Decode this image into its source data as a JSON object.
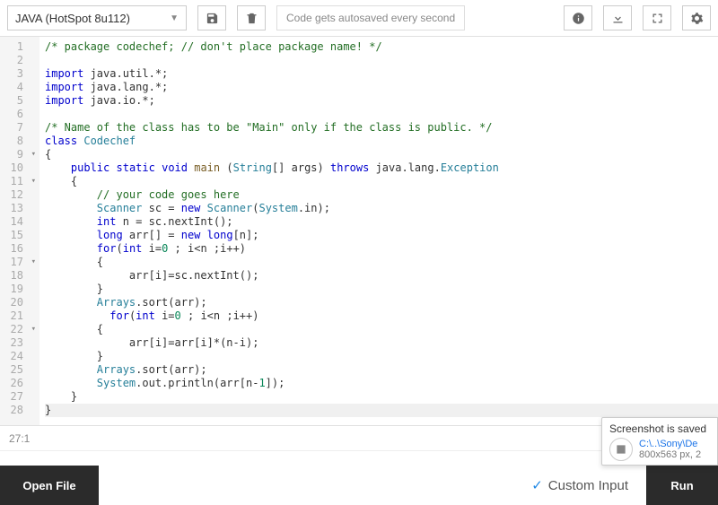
{
  "toolbar": {
    "language": "JAVA (HotSpot 8u112)",
    "autosave_msg": "Code gets autosaved every second"
  },
  "editor": {
    "lines": [
      {
        "n": 1,
        "fold": false,
        "tokens": [
          [
            "com",
            "/* package codechef; // don't place package name! */"
          ]
        ]
      },
      {
        "n": 2,
        "fold": false,
        "tokens": [
          [
            "id",
            ""
          ]
        ]
      },
      {
        "n": 3,
        "fold": false,
        "tokens": [
          [
            "kw",
            "import"
          ],
          [
            "id",
            " java.util.*;"
          ]
        ]
      },
      {
        "n": 4,
        "fold": false,
        "tokens": [
          [
            "kw",
            "import"
          ],
          [
            "id",
            " java.lang.*;"
          ]
        ]
      },
      {
        "n": 5,
        "fold": false,
        "tokens": [
          [
            "kw",
            "import"
          ],
          [
            "id",
            " java.io.*;"
          ]
        ]
      },
      {
        "n": 6,
        "fold": false,
        "tokens": [
          [
            "id",
            ""
          ]
        ]
      },
      {
        "n": 7,
        "fold": false,
        "tokens": [
          [
            "com",
            "/* Name of the class has to be \"Main\" only if the class is public. */"
          ]
        ]
      },
      {
        "n": 8,
        "fold": false,
        "tokens": [
          [
            "kw",
            "class"
          ],
          [
            "id",
            " "
          ],
          [
            "type",
            "Codechef"
          ]
        ]
      },
      {
        "n": 9,
        "fold": true,
        "tokens": [
          [
            "id",
            "{"
          ]
        ]
      },
      {
        "n": 10,
        "fold": false,
        "tokens": [
          [
            "id",
            "    "
          ],
          [
            "kw",
            "public"
          ],
          [
            "id",
            " "
          ],
          [
            "kw",
            "static"
          ],
          [
            "id",
            " "
          ],
          [
            "kw",
            "void"
          ],
          [
            "id",
            " "
          ],
          [
            "pkg",
            "main"
          ],
          [
            "id",
            " ("
          ],
          [
            "type",
            "String"
          ],
          [
            "id",
            "[] args) "
          ],
          [
            "kw",
            "throws"
          ],
          [
            "id",
            " java.lang."
          ],
          [
            "type",
            "Exception"
          ]
        ]
      },
      {
        "n": 11,
        "fold": true,
        "tokens": [
          [
            "id",
            "    {"
          ]
        ]
      },
      {
        "n": 12,
        "fold": false,
        "tokens": [
          [
            "id",
            "        "
          ],
          [
            "com",
            "// your code goes here"
          ]
        ]
      },
      {
        "n": 13,
        "fold": false,
        "tokens": [
          [
            "id",
            "        "
          ],
          [
            "type",
            "Scanner"
          ],
          [
            "id",
            " sc = "
          ],
          [
            "kw",
            "new"
          ],
          [
            "id",
            " "
          ],
          [
            "type",
            "Scanner"
          ],
          [
            "id",
            "("
          ],
          [
            "type",
            "System"
          ],
          [
            "id",
            ".in);"
          ]
        ]
      },
      {
        "n": 14,
        "fold": false,
        "tokens": [
          [
            "id",
            "        "
          ],
          [
            "kw",
            "int"
          ],
          [
            "id",
            " n = sc.nextInt();"
          ]
        ]
      },
      {
        "n": 15,
        "fold": false,
        "tokens": [
          [
            "id",
            "        "
          ],
          [
            "kw",
            "long"
          ],
          [
            "id",
            " arr[] = "
          ],
          [
            "kw",
            "new"
          ],
          [
            "id",
            " "
          ],
          [
            "kw",
            "long"
          ],
          [
            "id",
            "[n];"
          ]
        ]
      },
      {
        "n": 16,
        "fold": false,
        "tokens": [
          [
            "id",
            "        "
          ],
          [
            "kw",
            "for"
          ],
          [
            "id",
            "("
          ],
          [
            "kw",
            "int"
          ],
          [
            "id",
            " i="
          ],
          [
            "num",
            "0"
          ],
          [
            "id",
            " ; i<n ;i++)"
          ]
        ]
      },
      {
        "n": 17,
        "fold": true,
        "tokens": [
          [
            "id",
            "        {"
          ]
        ]
      },
      {
        "n": 18,
        "fold": false,
        "tokens": [
          [
            "id",
            "             arr[i]=sc.nextInt();"
          ]
        ]
      },
      {
        "n": 19,
        "fold": false,
        "tokens": [
          [
            "id",
            "        }"
          ]
        ]
      },
      {
        "n": 20,
        "fold": false,
        "tokens": [
          [
            "id",
            "        "
          ],
          [
            "type",
            "Arrays"
          ],
          [
            "id",
            ".sort(arr);"
          ]
        ]
      },
      {
        "n": 21,
        "fold": false,
        "tokens": [
          [
            "id",
            "          "
          ],
          [
            "kw",
            "for"
          ],
          [
            "id",
            "("
          ],
          [
            "kw",
            "int"
          ],
          [
            "id",
            " i="
          ],
          [
            "num",
            "0"
          ],
          [
            "id",
            " ; i<n ;i++)"
          ]
        ]
      },
      {
        "n": 22,
        "fold": true,
        "tokens": [
          [
            "id",
            "        {"
          ]
        ]
      },
      {
        "n": 23,
        "fold": false,
        "tokens": [
          [
            "id",
            "             arr[i]=arr[i]*(n-i);"
          ]
        ]
      },
      {
        "n": 24,
        "fold": false,
        "tokens": [
          [
            "id",
            "        }"
          ]
        ]
      },
      {
        "n": 25,
        "fold": false,
        "tokens": [
          [
            "id",
            "        "
          ],
          [
            "type",
            "Arrays"
          ],
          [
            "id",
            ".sort(arr);"
          ]
        ]
      },
      {
        "n": 26,
        "fold": false,
        "tokens": [
          [
            "id",
            "        "
          ],
          [
            "type",
            "System"
          ],
          [
            "id",
            ".out.println(arr[n-"
          ],
          [
            "num",
            "1"
          ],
          [
            "id",
            "]);"
          ]
        ]
      },
      {
        "n": 27,
        "fold": false,
        "tokens": [
          [
            "id",
            "    }"
          ]
        ]
      },
      {
        "n": 28,
        "fold": false,
        "active": true,
        "tokens": [
          [
            "id",
            "}"
          ]
        ]
      }
    ]
  },
  "status": {
    "cursor": "27:1"
  },
  "footer": {
    "open_file_label": "Open File",
    "custom_input_label": "Custom Input",
    "run_label": "Run"
  },
  "toast": {
    "title": "Screenshot is saved",
    "path": "C:\\..\\Sony\\De",
    "meta": "800x563 px, 2"
  }
}
